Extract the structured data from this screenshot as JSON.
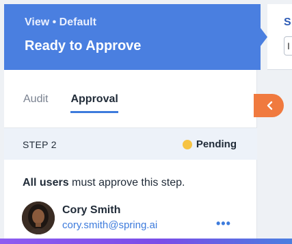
{
  "header": {
    "view_label": "View • Default",
    "title": "Ready to Approve"
  },
  "right_panel": {
    "partial_label": "S",
    "partial_field": "I"
  },
  "tabs": [
    {
      "label": "Audit",
      "active": false
    },
    {
      "label": "Approval",
      "active": true
    }
  ],
  "step": {
    "label": "STEP 2",
    "status": "Pending",
    "status_color": "#f6c343"
  },
  "rule": {
    "bold": "All users",
    "rest": " must approve this step."
  },
  "approver": {
    "name": "Cory Smith",
    "email": "cory.smith@spring.ai",
    "more": "•••"
  },
  "colors": {
    "header": "#4a7fe0",
    "accent": "#3d7bdc",
    "collapse_button": "#f07a3f"
  },
  "icons": {
    "collapse": "chevron-left-icon",
    "more": "more-horizontal-icon"
  }
}
